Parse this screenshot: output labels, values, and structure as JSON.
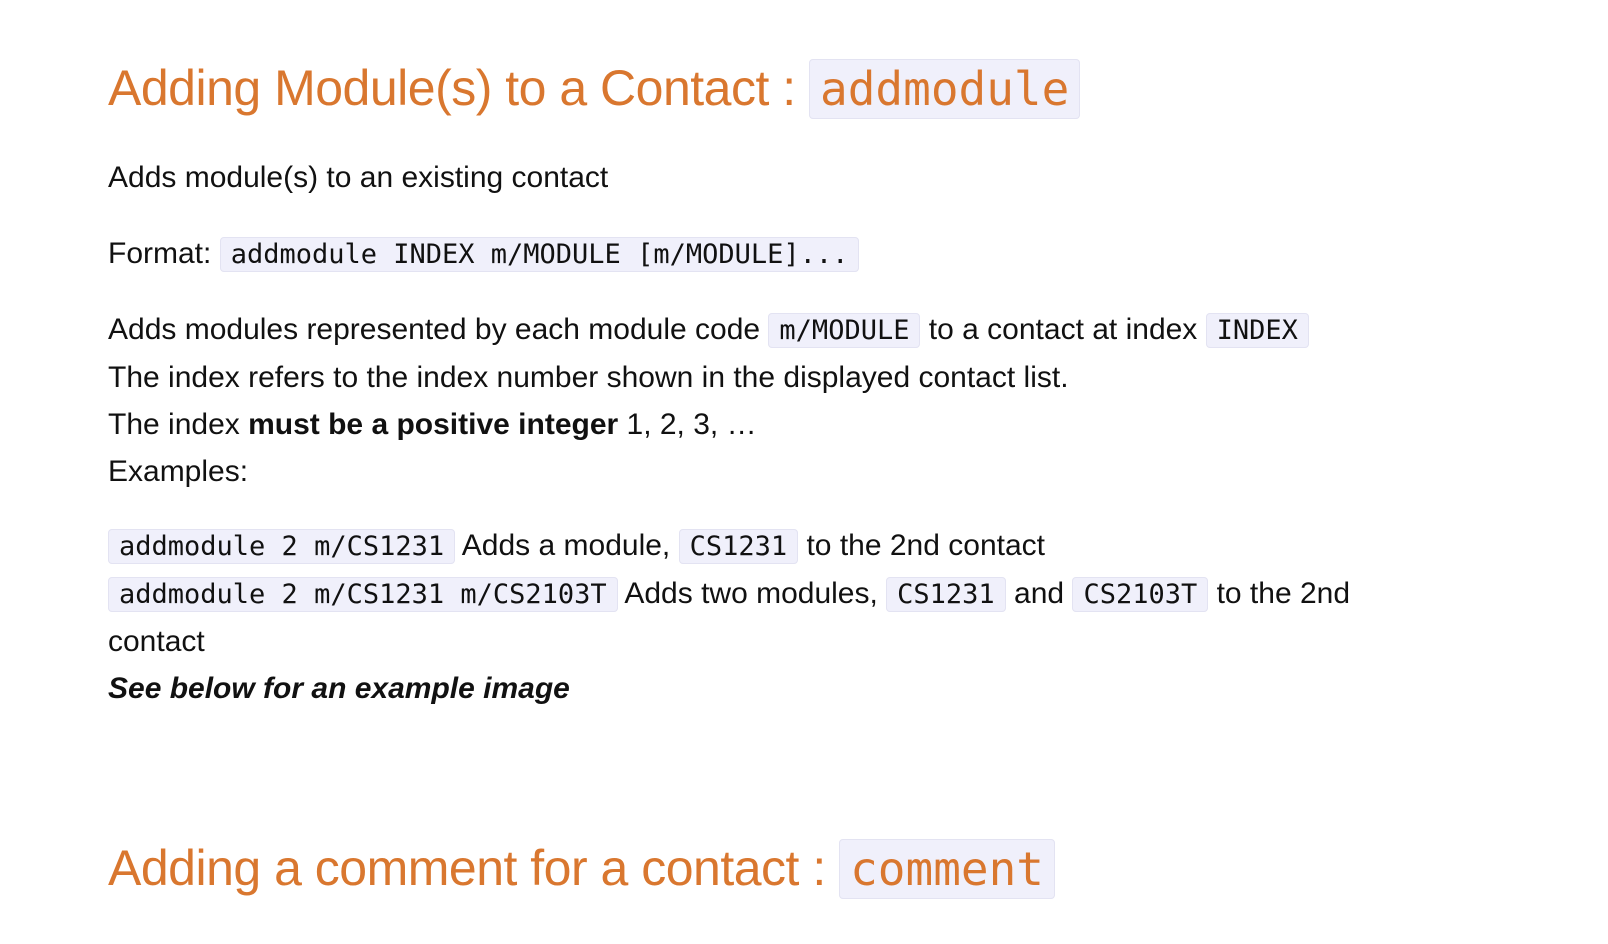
{
  "section1": {
    "heading_text": "Adding Module(s) to a Contact : ",
    "heading_code": "addmodule",
    "description": "Adds module(s) to an existing contact",
    "format_label": "Format: ",
    "format_code": "addmodule INDEX m/MODULE [m/MODULE]...",
    "detail": {
      "line1_pre": "Adds modules represented by each module code ",
      "line1_code1": "m/MODULE",
      "line1_mid": " to a contact at index ",
      "line1_code2": "INDEX",
      "line2": "The index refers to the index number shown in the displayed contact list.",
      "line3_pre": "The index ",
      "line3_bold": "must be a positive integer",
      "line3_post": " 1, 2, 3, …",
      "line4": "Examples:"
    },
    "examples": {
      "ex1_code": "addmodule 2 m/CS1231",
      "ex1_text": " Adds a module, ",
      "ex1_code2": "CS1231",
      "ex1_post": " to the 2nd contact",
      "ex2_code": "addmodule 2 m/CS1231 m/CS2103T",
      "ex2_text": " Adds two modules, ",
      "ex2_code2": "CS1231",
      "ex2_and": " and ",
      "ex2_code3": "CS2103T",
      "ex2_post": " to the 2nd",
      "ex2_wrap": "contact",
      "note": "See below for an example image"
    }
  },
  "section2": {
    "heading_text": "Adding a comment for a contact : ",
    "heading_code": "comment"
  },
  "colors": {
    "heading": "#d9772f",
    "code_bg": "#f0f0fb",
    "text": "#111111"
  }
}
